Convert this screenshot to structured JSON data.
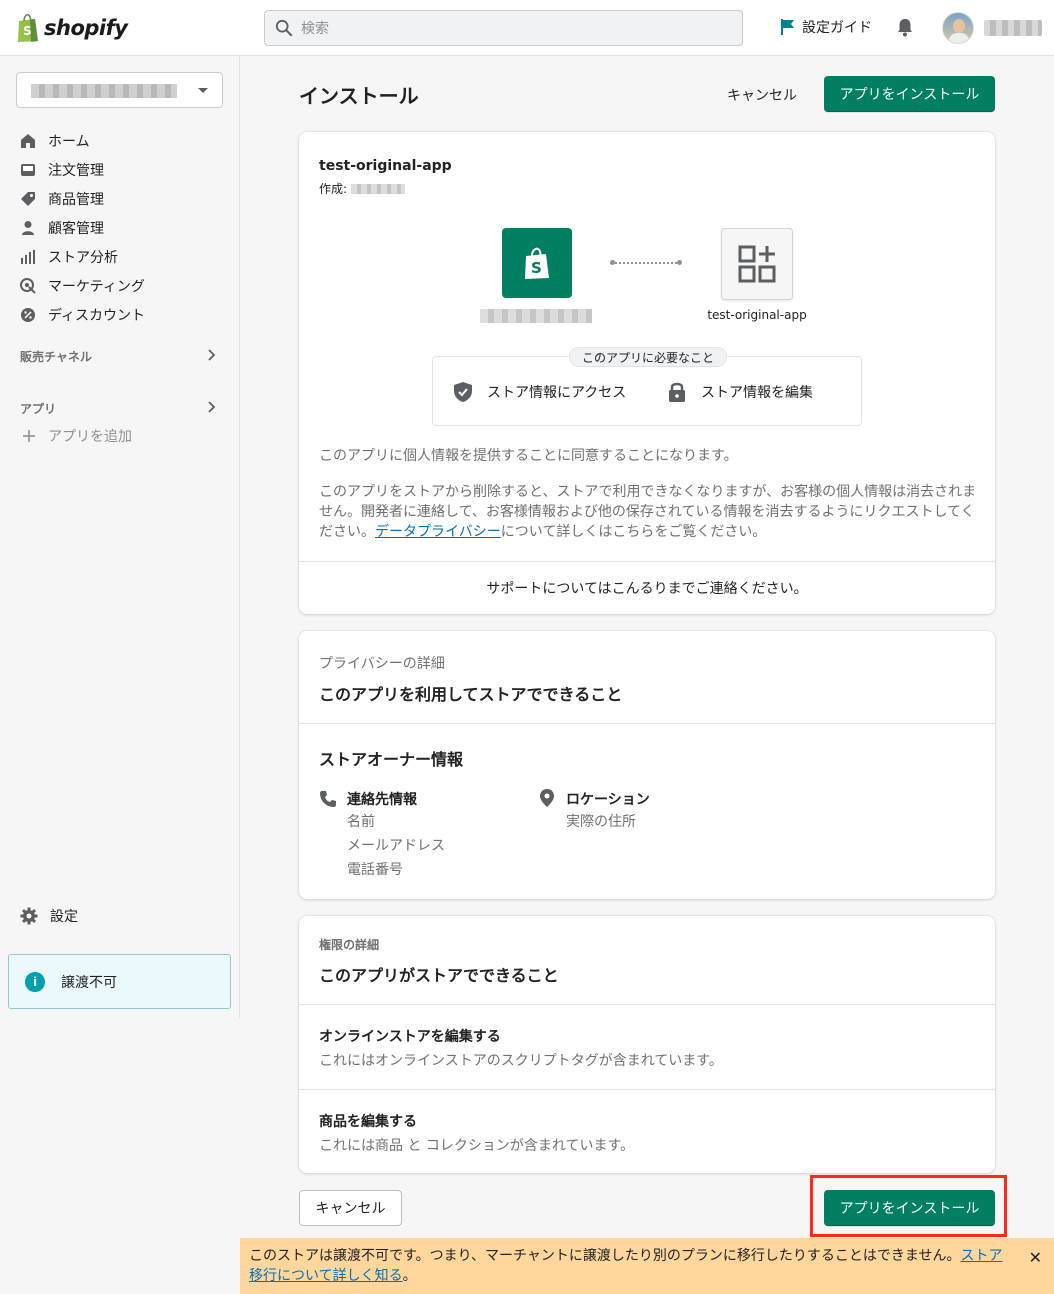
{
  "header": {
    "logo_text": "shopify",
    "search_placeholder": "検索",
    "setup_guide": "設定ガイド"
  },
  "sidebar": {
    "nav": [
      {
        "label": "ホーム",
        "icon": "home-icon"
      },
      {
        "label": "注文管理",
        "icon": "orders-icon"
      },
      {
        "label": "商品管理",
        "icon": "tag-icon"
      },
      {
        "label": "顧客管理",
        "icon": "person-icon"
      },
      {
        "label": "ストア分析",
        "icon": "analytics-icon"
      },
      {
        "label": "マーケティング",
        "icon": "target-icon"
      },
      {
        "label": "ディスカウント",
        "icon": "discount-icon"
      }
    ],
    "sales_channels": "販売チャネル",
    "apps": "アプリ",
    "add_app": "アプリを追加",
    "settings": "設定",
    "nontransferable": "譲渡不可"
  },
  "page": {
    "title": "インストール",
    "cancel": "キャンセル",
    "install": "アプリをインストール"
  },
  "install_card": {
    "app_name": "test-original-app",
    "made_by_label": "作成:",
    "app_tile_label": "test-original-app",
    "requirements_tag": "このアプリに必要なこと",
    "req_access": "ストア情報にアクセス",
    "req_edit": "ストア情報を編集",
    "consent_text": "このアプリに個人情報を提供することに同意することになります。",
    "removal_text": "このアプリをストアから削除すると、ストアで利用できなくなりますが、お客様の個人情報は消去されません。開発者に連絡して、お客様情報および他の保存されている情報を消去するようにリクエストしてください。",
    "privacy_link": "データプライバシー",
    "privacy_suffix": "について詳しくはこちらをご覧ください。",
    "support_text": "サポートについてはこんるりまでご連絡ください。"
  },
  "privacy_card": {
    "muted_title": "プライバシーの詳細",
    "title": "このアプリを利用してストアでできること",
    "owner_info": "ストアオーナー情報",
    "contact_title": "連絡先情報",
    "contact_items": [
      "名前",
      "メールアドレス",
      "電話番号"
    ],
    "location_title": "ロケーション",
    "location_items": [
      "実際の住所"
    ]
  },
  "permissions_card": {
    "muted_title": "権限の詳細",
    "title": "このアプリがストアでできること",
    "perm1_title": "オンラインストアを編集する",
    "perm1_desc": "これにはオンラインストアのスクリプトタグが含まれています。",
    "perm2_title": "商品を編集する",
    "perm2_desc": "これには商品 と コレクションが含まれています。"
  },
  "footer": {
    "cancel": "キャンセル",
    "install": "アプリをインストール"
  },
  "banner": {
    "text": "このストアは譲渡不可です。つまり、マーチャントに譲渡したり別のプランに移行したりすることはできません。",
    "link": "ストア移行について詳しく知る",
    "suffix": "。",
    "close": "✕"
  },
  "colors": {
    "primary": "#008060",
    "banner": "#ffd79d",
    "highlight": "#ff2a1a",
    "info": "#00a0ac"
  }
}
